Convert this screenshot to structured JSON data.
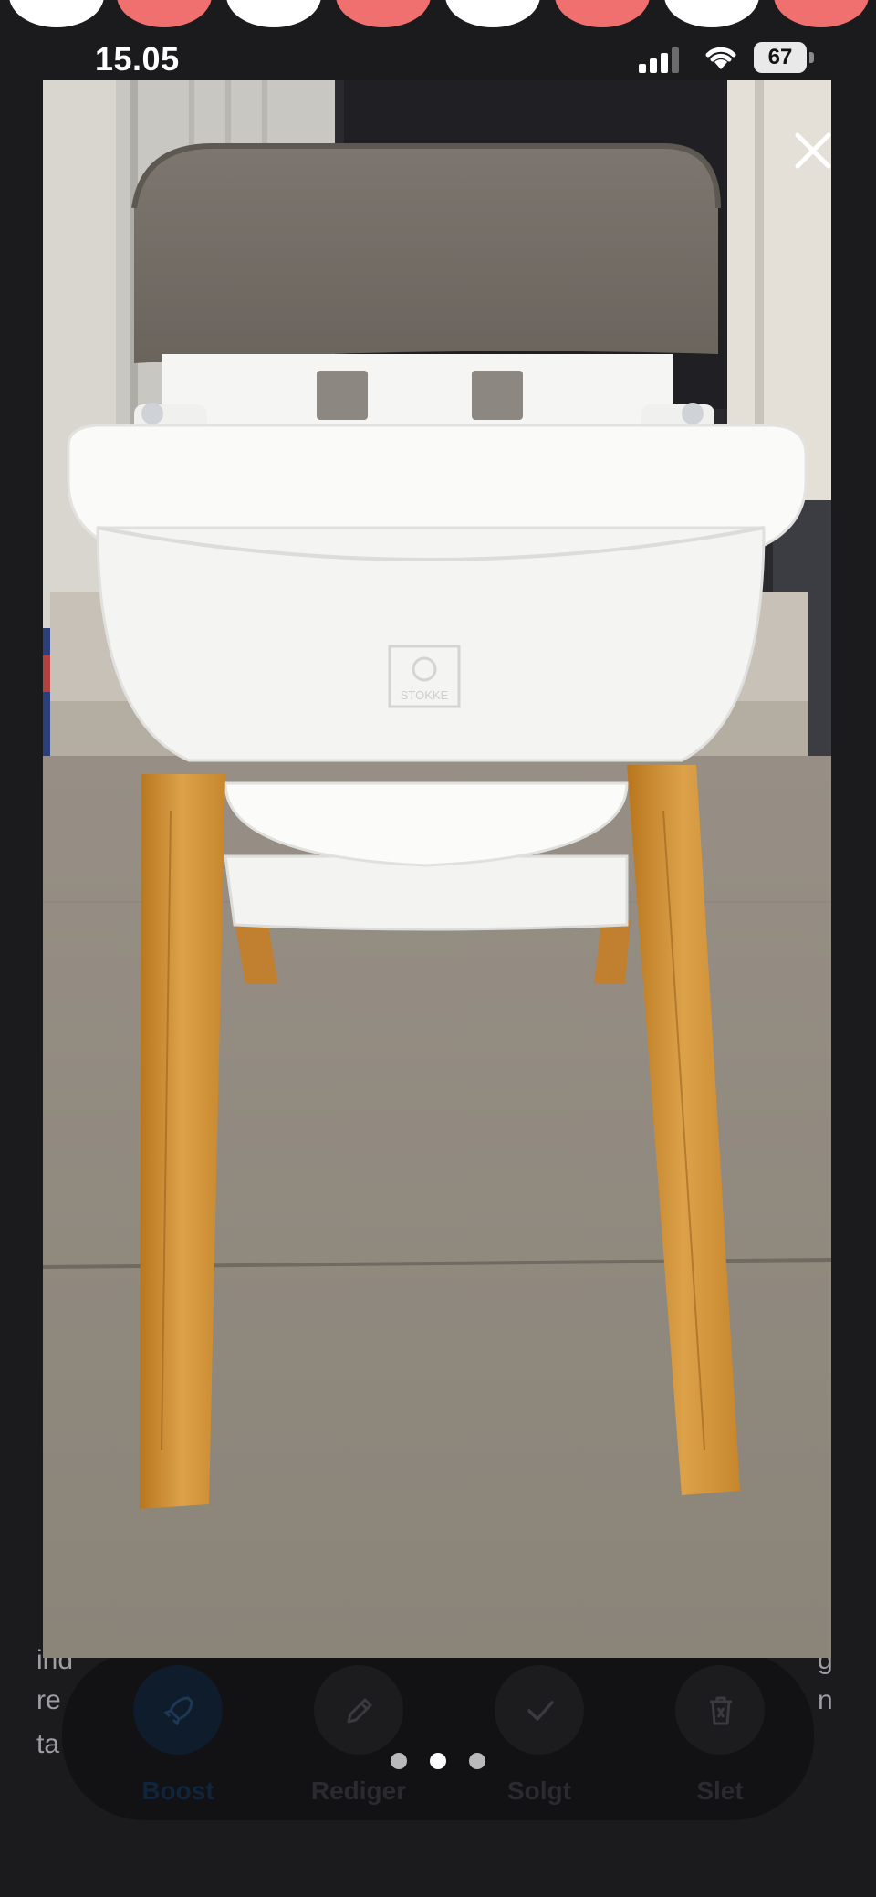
{
  "status_bar": {
    "time": "15.05",
    "battery_level": "67"
  },
  "underlying_listing": {
    "description_fragments": [
      "ind",
      "re",
      "ta",
      "g",
      "n"
    ],
    "actions": [
      {
        "label": "Boost",
        "icon": "rocket-icon"
      },
      {
        "label": "Rediger",
        "icon": "pencil-icon"
      },
      {
        "label": "Solgt",
        "icon": "checkmark-icon"
      },
      {
        "label": "Slet",
        "icon": "trash-icon"
      }
    ]
  },
  "photo_viewer": {
    "photo_subject": "Stokke high chair with grey cushion and oak legs",
    "brand_mark": "STOKKE",
    "current_photo": 2,
    "total_photos": 3,
    "close_icon": "close-icon"
  },
  "colors": {
    "page_background": "#1b1b1d",
    "top_dot_white": "#ffffff",
    "top_dot_coral": "#f07070",
    "pager_active": "#ffffff",
    "pager_inactive": "#b9b9bb"
  }
}
